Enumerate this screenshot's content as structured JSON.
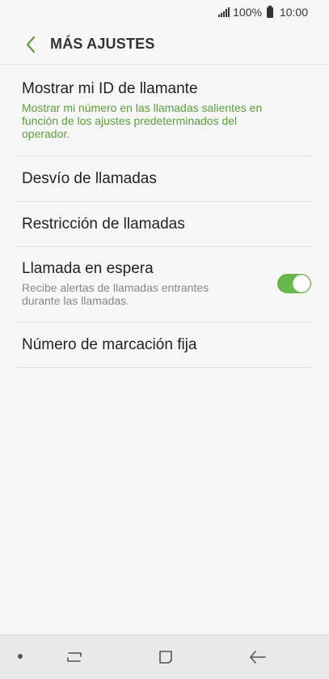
{
  "status_bar": {
    "battery": "100%",
    "time": "10:00"
  },
  "header": {
    "title": "MÁS AJUSTES"
  },
  "items": [
    {
      "title": "Mostrar mi ID de llamante",
      "subtitle": "Mostrar mi número en las llamadas salientes en función de los ajustes predeterminados del operador."
    },
    {
      "title": "Desvío de llamadas"
    },
    {
      "title": "Restricción de llamadas"
    },
    {
      "title": "Llamada en espera",
      "subtitle": "Recibe alertas de llamadas entrantes durante las llamadas.",
      "toggle_on": true
    },
    {
      "title": "Número de marcación fija"
    }
  ],
  "colors": {
    "accent": "#5a9e3b",
    "toggle": "#67b84a"
  },
  "icons": {
    "back": "chevron-left-icon",
    "nav_recent": "recent-apps-icon",
    "nav_home": "home-icon",
    "nav_back": "back-arrow-icon"
  }
}
